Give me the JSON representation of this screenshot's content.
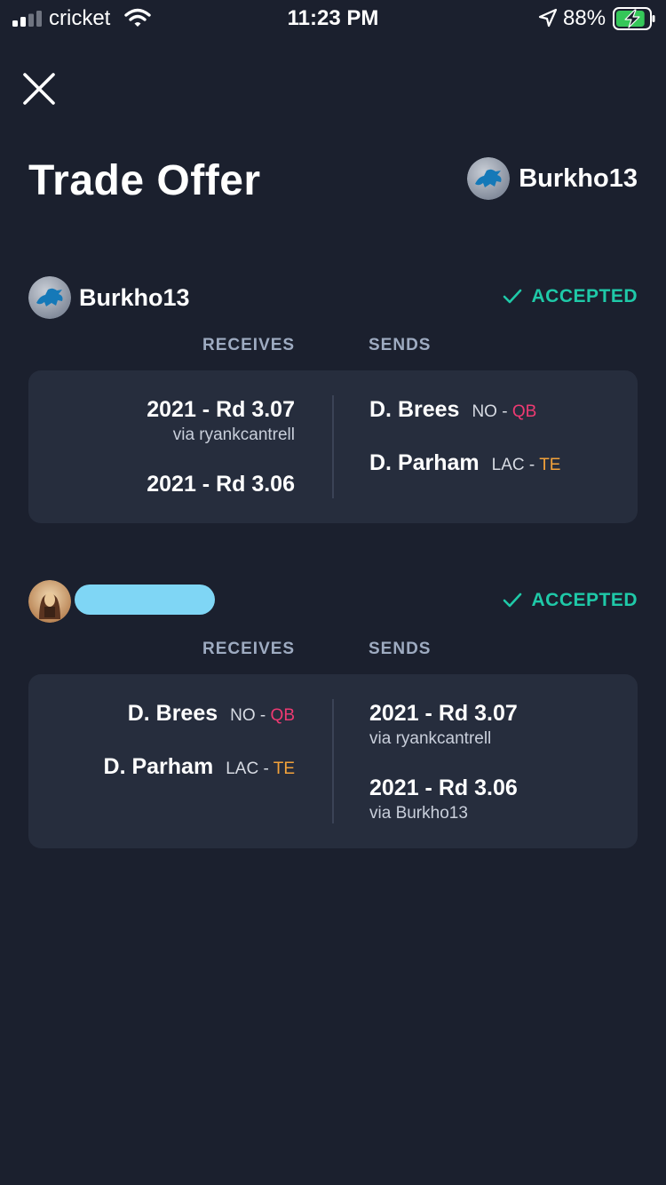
{
  "status_bar": {
    "carrier": "cricket",
    "time": "11:23 PM",
    "battery_pct": "88%",
    "signal_bars_active": 2,
    "battery_level": 0.88
  },
  "page": {
    "title": "Trade Offer"
  },
  "header_user": {
    "name": "Burkho13"
  },
  "parties": [
    {
      "name": "Burkho13",
      "status": "ACCEPTED",
      "receives_label": "RECEIVES",
      "sends_label": "SENDS",
      "receives": [
        {
          "title": "2021 - Rd 3.07",
          "via": "via ryankcantrell"
        },
        {
          "title": "2021 - Rd 3.06"
        }
      ],
      "sends": [
        {
          "name": "D. Brees",
          "team": "NO - ",
          "pos": "QB"
        },
        {
          "name": "D. Parham",
          "team": "LAC - ",
          "pos": "TE"
        }
      ]
    },
    {
      "name": "",
      "status": "ACCEPTED",
      "receives_label": "RECEIVES",
      "sends_label": "SENDS",
      "receives": [
        {
          "name": "D. Brees",
          "team": "NO - ",
          "pos": "QB"
        },
        {
          "name": "D. Parham",
          "team": "LAC - ",
          "pos": "TE"
        }
      ],
      "sends": [
        {
          "title": "2021 - Rd 3.07",
          "via": "via ryankcantrell"
        },
        {
          "title": "2021 - Rd 3.06",
          "via": "via Burkho13"
        }
      ]
    }
  ],
  "colors": {
    "background": "#1b202e",
    "card": "#262d3d",
    "accepted": "#1fc9a8",
    "qb": "#ee3a72",
    "te": "#f3a23a",
    "battery": "#35c759"
  }
}
